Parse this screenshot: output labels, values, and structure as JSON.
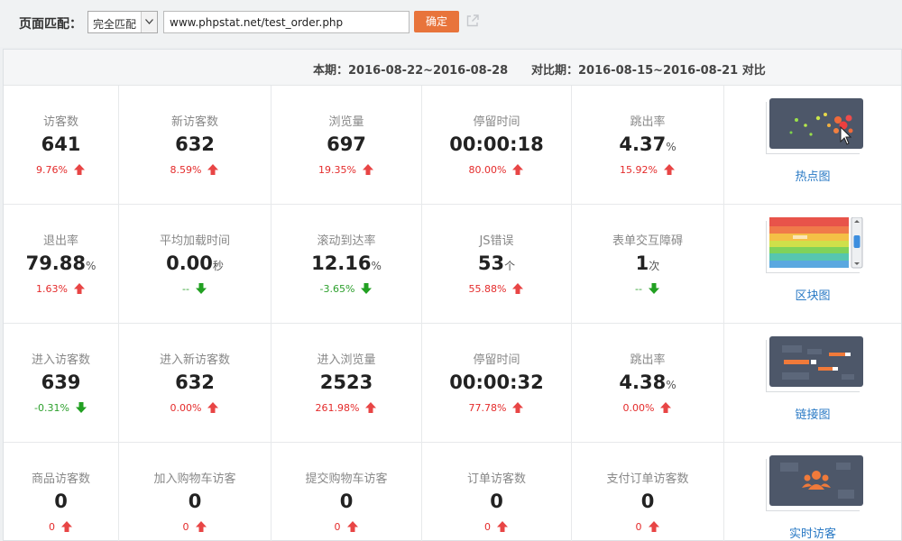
{
  "toolbar": {
    "label": "页面匹配：",
    "match_select": "完全匹配",
    "url_value": "www.phpstat.net/test_order.php",
    "confirm_label": "确定"
  },
  "period": {
    "current": "本期：2016-08-22~2016-08-28",
    "compare": "对比期：2016-08-15~2016-08-21 对比"
  },
  "rows": [
    {
      "metrics": [
        {
          "label": "访客数",
          "value": "641",
          "unit": "",
          "change": "9.76%",
          "dir": "up"
        },
        {
          "label": "新访客数",
          "value": "632",
          "unit": "",
          "change": "8.59%",
          "dir": "up"
        },
        {
          "label": "浏览量",
          "value": "697",
          "unit": "",
          "change": "19.35%",
          "dir": "up"
        },
        {
          "label": "停留时间",
          "value": "00:00:18",
          "unit": "",
          "change": "80.00%",
          "dir": "up"
        },
        {
          "label": "跳出率",
          "value": "4.37",
          "unit": "%",
          "change": "15.92%",
          "dir": "up"
        }
      ],
      "thumb": {
        "label": "热点图",
        "icon": "heatmap-thumbnail"
      }
    },
    {
      "metrics": [
        {
          "label": "退出率",
          "value": "79.88",
          "unit": "%",
          "change": "1.63%",
          "dir": "up"
        },
        {
          "label": "平均加载时间",
          "value": "0.00",
          "unit": "秒",
          "change": "--",
          "dir": "down"
        },
        {
          "label": "滚动到达率",
          "value": "12.16",
          "unit": "%",
          "change": "-3.65%",
          "dir": "down"
        },
        {
          "label": "JS错误",
          "value": "53",
          "unit": "个",
          "change": "55.88%",
          "dir": "up"
        },
        {
          "label": "表单交互障碍",
          "value": "1",
          "unit": "次",
          "change": "--",
          "dir": "down"
        }
      ],
      "thumb": {
        "label": "区块图",
        "icon": "block-map-thumbnail"
      }
    },
    {
      "metrics": [
        {
          "label": "进入访客数",
          "value": "639",
          "unit": "",
          "change": "-0.31%",
          "dir": "down"
        },
        {
          "label": "进入新访客数",
          "value": "632",
          "unit": "",
          "change": "0.00%",
          "dir": "up"
        },
        {
          "label": "进入浏览量",
          "value": "2523",
          "unit": "",
          "change": "261.98%",
          "dir": "up"
        },
        {
          "label": "停留时间",
          "value": "00:00:32",
          "unit": "",
          "change": "77.78%",
          "dir": "up"
        },
        {
          "label": "跳出率",
          "value": "4.38",
          "unit": "%",
          "change": "0.00%",
          "dir": "up"
        }
      ],
      "thumb": {
        "label": "链接图",
        "icon": "link-map-thumbnail"
      }
    },
    {
      "metrics": [
        {
          "label": "商品访客数",
          "value": "0",
          "unit": "",
          "change": "0",
          "dir": "up"
        },
        {
          "label": "加入购物车访客",
          "value": "0",
          "unit": "",
          "change": "0",
          "dir": "up"
        },
        {
          "label": "提交购物车访客",
          "value": "0",
          "unit": "",
          "change": "0",
          "dir": "up"
        },
        {
          "label": "订单访客数",
          "value": "0",
          "unit": "",
          "change": "0",
          "dir": "up"
        },
        {
          "label": "支付订单访客数",
          "value": "0",
          "unit": "",
          "change": "0",
          "dir": "up"
        }
      ],
      "thumb": {
        "label": "实时访客",
        "icon": "realtime-visitors-thumbnail"
      }
    }
  ],
  "colors": {
    "up": "#e42b2b",
    "down": "#2da02d",
    "accent_button": "#e8743b",
    "link": "#2a7ac5"
  }
}
